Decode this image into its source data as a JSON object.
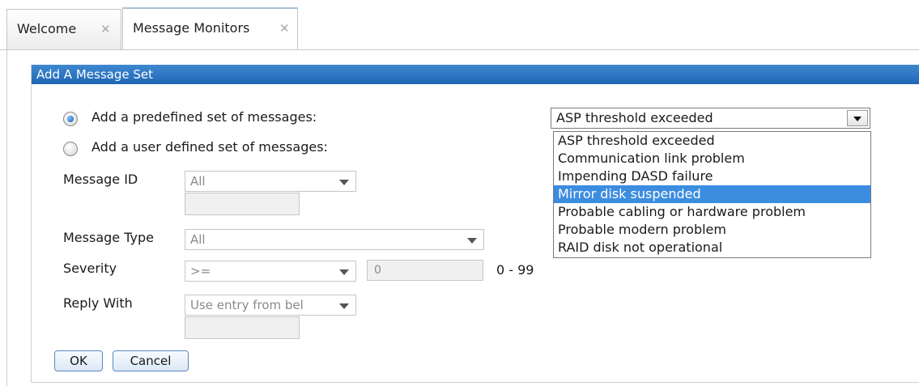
{
  "tabs": [
    {
      "label": "Welcome",
      "close": "✕"
    },
    {
      "label": "Message Monitors",
      "close": "✕"
    }
  ],
  "dialog": {
    "title": "Add A Message Set"
  },
  "options": {
    "predefined_label": "Add a predefined set of messages:",
    "user_defined_label": "Add a user defined set of messages:",
    "selected": "predefined"
  },
  "form": {
    "message_id": {
      "label": "Message ID",
      "value": "All"
    },
    "message_type": {
      "label": "Message Type",
      "value": "All"
    },
    "severity": {
      "label": "Severity",
      "operator": ">=",
      "value": "0",
      "range": "0 - 99"
    },
    "reply_with": {
      "label": "Reply With",
      "value": "Use entry from bel"
    }
  },
  "buttons": {
    "ok": "OK",
    "cancel": "Cancel"
  },
  "predefined_select": {
    "value": "ASP threshold exceeded",
    "options": [
      "ASP threshold exceeded",
      "Communication link problem",
      "Impending DASD failure",
      "Mirror disk suspended",
      "Probable cabling or hardware problem",
      "Probable modern problem",
      "RAID disk not operational"
    ],
    "highlighted_index": 3
  },
  "colors": {
    "title_bar": "#1f66b5",
    "highlight": "#3c8de0"
  }
}
